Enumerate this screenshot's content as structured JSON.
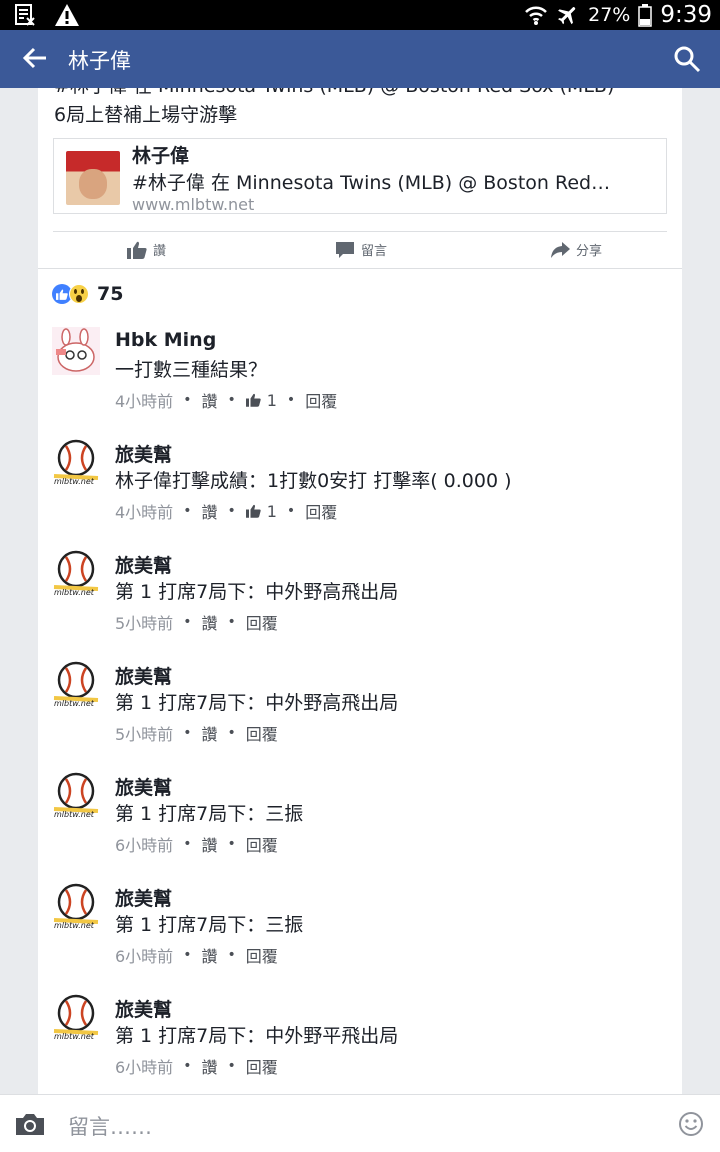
{
  "status_bar": {
    "battery": "27%",
    "time": "9:39"
  },
  "app_bar": {
    "title": "林子偉"
  },
  "post": {
    "text_line1": "#林子偉 在 Minnesota Twins (MLB) @ Boston Red Sox (MLB)",
    "text_line2": "6局上替補上場守游擊",
    "link": {
      "title": "林子偉",
      "description": "#林子偉 在 Minnesota Twins (MLB) @ Boston Red…",
      "url": "www.mlbtw.net"
    },
    "actions": {
      "like": "讚",
      "comment": "留言",
      "share": "分享"
    },
    "reaction_count": "75"
  },
  "comments": [
    {
      "name": "Hbk Ming",
      "text": "一打數三種結果？",
      "time": "4小時前",
      "like": "讚",
      "likes": "1",
      "reply": "回覆"
    },
    {
      "name": "旅美幫",
      "text": "林子偉打擊成績：1打數0安打 打擊率( 0.000 )",
      "time": "4小時前",
      "like": "讚",
      "likes": "1",
      "reply": "回覆"
    },
    {
      "name": "旅美幫",
      "text": "第 1 打席7局下：中外野高飛出局",
      "time": "5小時前",
      "like": "讚",
      "reply": "回覆"
    },
    {
      "name": "旅美幫",
      "text": "第 1 打席7局下：中外野高飛出局",
      "time": "5小時前",
      "like": "讚",
      "reply": "回覆"
    },
    {
      "name": "旅美幫",
      "text": "第 1 打席7局下：三振",
      "time": "6小時前",
      "like": "讚",
      "reply": "回覆"
    },
    {
      "name": "旅美幫",
      "text": "第 1 打席7局下：三振",
      "time": "6小時前",
      "like": "讚",
      "reply": "回覆"
    },
    {
      "name": "旅美幫",
      "text": "第 1 打席7局下：中外野平飛出局",
      "time": "6小時前",
      "like": "讚",
      "reply": "回覆"
    }
  ],
  "comment_input": {
    "placeholder": "留言……"
  },
  "colors": {
    "brand": "#3b5998",
    "link": "#4b4f56",
    "meta": "#90949c"
  }
}
